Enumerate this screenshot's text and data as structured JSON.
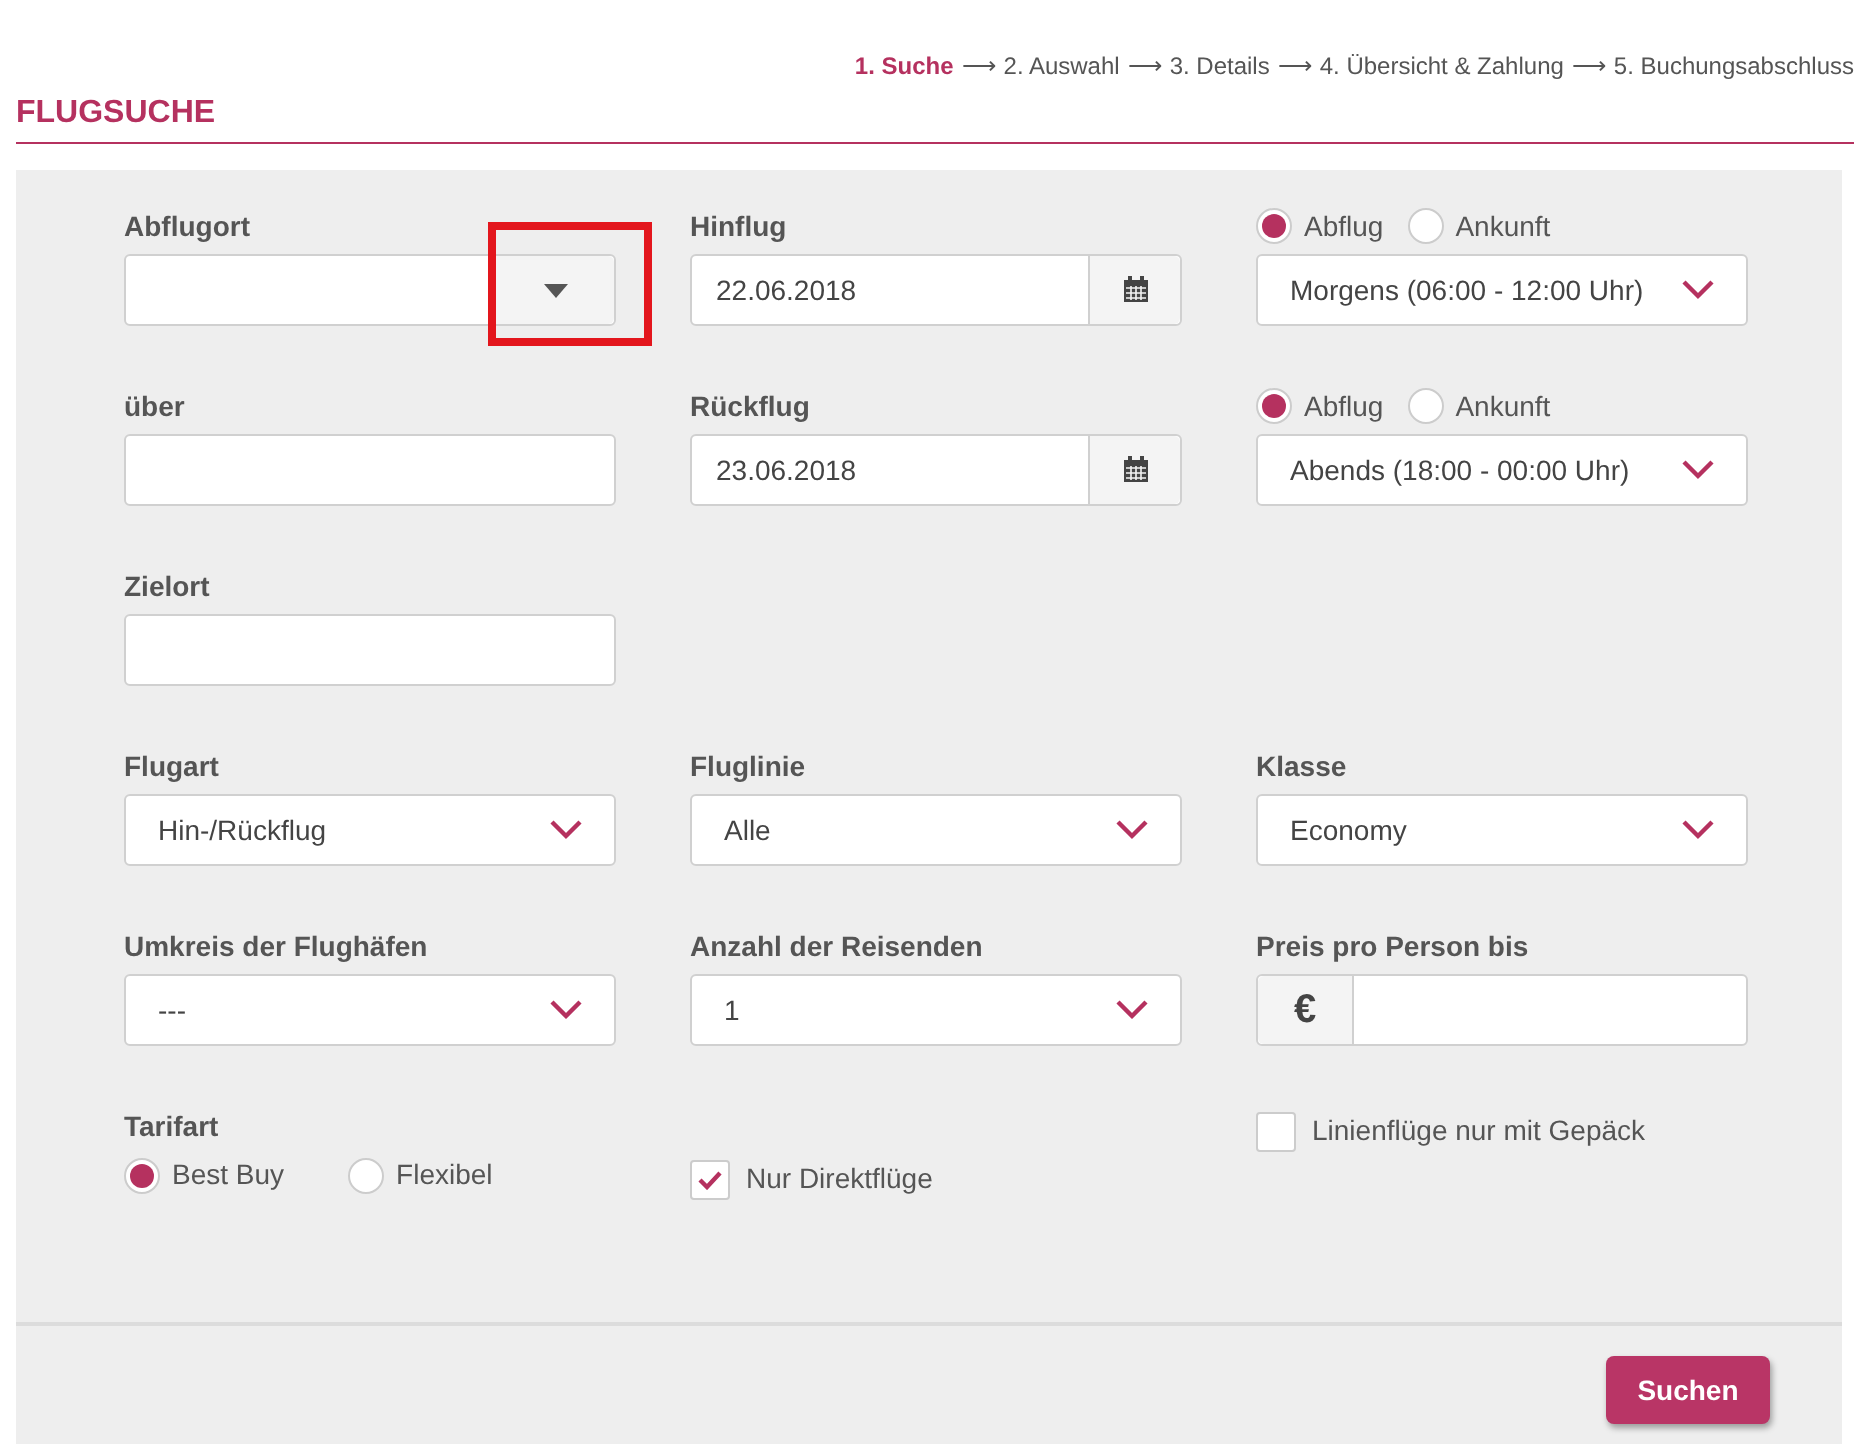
{
  "steps": [
    {
      "label": "1. Suche",
      "selected": true,
      "arrow_after": "⟶"
    },
    {
      "label": "2. Auswahl",
      "selected": false,
      "arrow_after": "⟶"
    },
    {
      "label": "3. Details",
      "selected": false,
      "arrow_after": "⟶"
    },
    {
      "label": "4. Übersicht & Zahlung",
      "selected": false,
      "arrow_after": "⟶"
    },
    {
      "label": "5. Buchungsabschluss",
      "selected": false
    }
  ],
  "title": "FLUGSUCHE",
  "rows": [
    [
      {
        "kind": "combo",
        "label": "Abflugort",
        "highlighted": true
      },
      {
        "kind": "date",
        "label": "Hinflug",
        "value": "22.06.2018"
      },
      {
        "kind": "time",
        "options": [
          {
            "label": "Abflug",
            "selected": true
          },
          {
            "label": "Ankunft",
            "selected": false
          }
        ],
        "value": "Morgens (06:00 - 12:00 Uhr)"
      }
    ],
    [
      {
        "kind": "text",
        "label": "über"
      },
      {
        "kind": "date",
        "label": "Rückflug",
        "value": "23.06.2018"
      },
      {
        "kind": "time",
        "options": [
          {
            "label": "Abflug",
            "selected": true
          },
          {
            "label": "Ankunft",
            "selected": false
          }
        ],
        "value": "Abends (18:00 - 00:00 Uhr)"
      }
    ],
    [
      {
        "kind": "text",
        "label": "Zielort"
      },
      {
        "kind": "empty"
      },
      {
        "kind": "empty"
      }
    ],
    [
      {
        "kind": "select",
        "label": "Flugart",
        "value": "Hin-/Rückflug"
      },
      {
        "kind": "select",
        "label": "Fluglinie",
        "value": "Alle"
      },
      {
        "kind": "select",
        "label": "Klasse",
        "value": "Economy"
      }
    ],
    [
      {
        "kind": "select",
        "label": "Umkreis der Flughäfen",
        "value": "---"
      },
      {
        "kind": "select",
        "label": "Anzahl der Reisenden",
        "value": "1"
      },
      {
        "kind": "price",
        "label": "Preis pro Person bis",
        "currency": "€"
      }
    ],
    [
      {
        "kind": "radios",
        "label": "Tarifart",
        "options": [
          {
            "label": "Best Buy",
            "selected": true
          },
          {
            "label": "Flexibel",
            "selected": false
          }
        ]
      },
      {
        "kind": "checkbox",
        "label": "Nur Direktflüge",
        "checked": true
      },
      {
        "kind": "raised_checkbox",
        "label": "Linienflüge nur mit Gepäck",
        "checked": false
      }
    ]
  ],
  "submit": "Suchen"
}
